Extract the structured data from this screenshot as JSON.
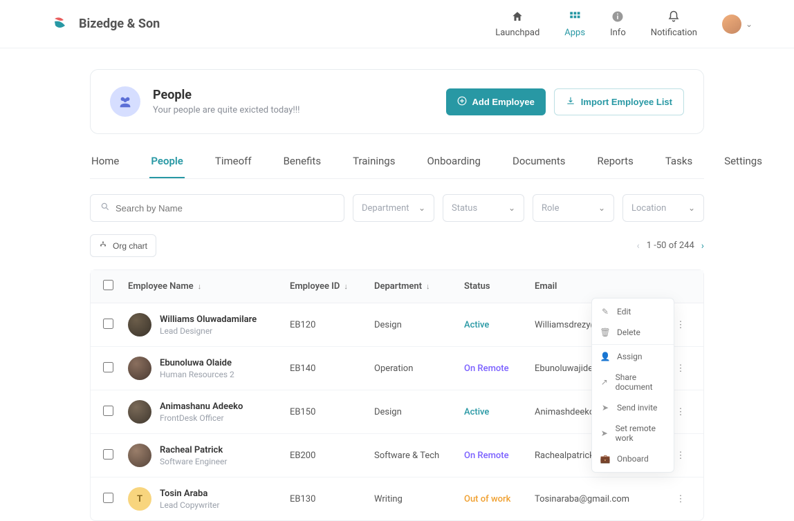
{
  "brand": {
    "name": "Bizedge & Son"
  },
  "topnav": {
    "launchpad": "Launchpad",
    "apps": "Apps",
    "info": "Info",
    "notification": "Notification"
  },
  "hero": {
    "title": "People",
    "subtitle": "Your people are quite exicted today!!!",
    "add_label": "Add Employee",
    "import_label": "Import Employee List"
  },
  "tabs": [
    "Home",
    "People",
    "Timeoff",
    "Benefits",
    "Trainings",
    "Onboarding",
    "Documents",
    "Reports",
    "Tasks",
    "Settings"
  ],
  "search": {
    "placeholder": "Search by Name"
  },
  "filters": {
    "department": "Department",
    "status": "Status",
    "role": "Role",
    "location": "Location"
  },
  "orgchart_label": "Org chart",
  "pagination": {
    "text": "1 -50 of 244"
  },
  "columns": {
    "name": "Employee Name",
    "id": "Employee ID",
    "dept": "Department",
    "status": "Status",
    "email": "Email"
  },
  "rows": [
    {
      "name": "Williams Oluwadamilare",
      "role": "Lead Designer",
      "id": "EB120",
      "dept": "Design",
      "status": "Active",
      "status_class": "Active",
      "email": "Williamsdrezy@"
    },
    {
      "name": "Ebunoluwa Olaide",
      "role": "Human Resources 2",
      "id": "EB140",
      "dept": "Operation",
      "status": "On Remote",
      "status_class": "OnRemote",
      "email": "Ebunoluwajide@"
    },
    {
      "name": "Animashanu Adeeko",
      "role": "FrontDesk Officer",
      "id": "EB150",
      "dept": "Design",
      "status": "Active",
      "status_class": "Active",
      "email": "Animashdeeko"
    },
    {
      "name": "Racheal Patrick",
      "role": "Software Engineer",
      "id": "EB200",
      "dept": "Software & Tech",
      "status": "On Remote",
      "status_class": "OnRemote",
      "email": "Rachealpatrick"
    },
    {
      "name": "Tosin Araba",
      "role": "Lead Copywriter",
      "id": "EB130",
      "dept": "Writing",
      "status": "Out of work",
      "status_class": "Out",
      "email": "Tosinaraba@gmail.com"
    }
  ],
  "menu": {
    "edit": "Edit",
    "delete": "Delete",
    "assign": "Assign",
    "share": "Share document",
    "invite": "Send invite",
    "remote": "Set remote work",
    "onboard": "Onboard"
  }
}
